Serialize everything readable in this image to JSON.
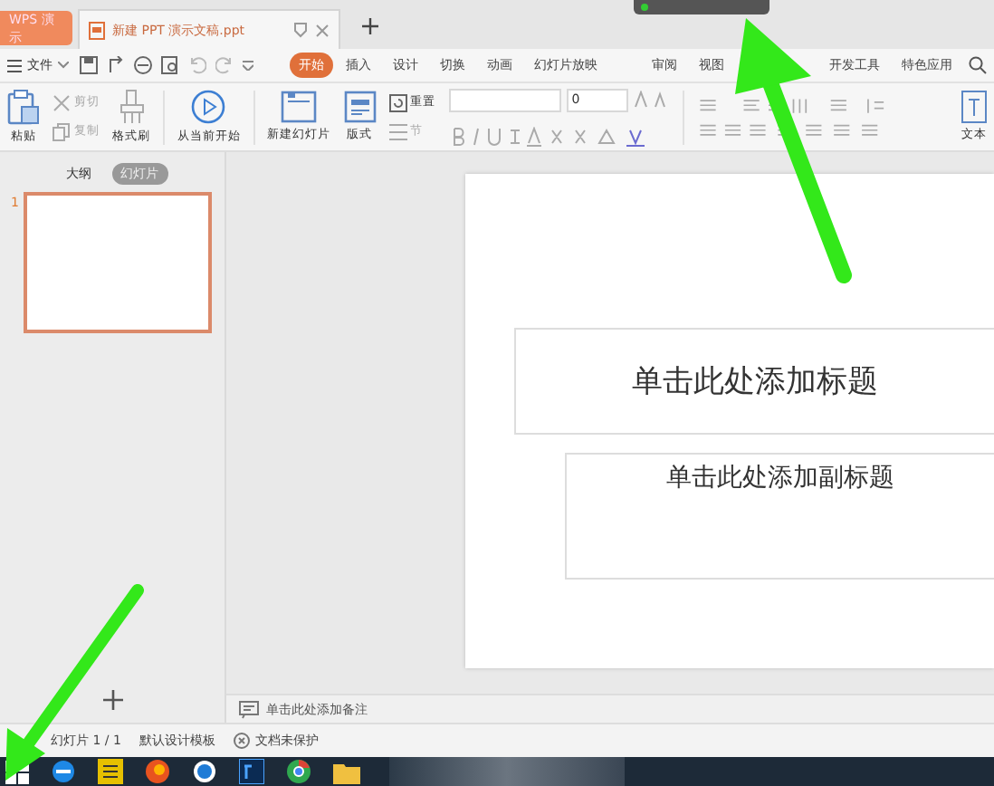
{
  "app_tabs": [
    {
      "label": "WPS 演示",
      "kind": "app",
      "selected": false
    },
    {
      "label": "新建 PPT 演示文稿.ppt",
      "kind": "doc",
      "selected": true
    }
  ],
  "menu": {
    "file": "文件",
    "items": [
      {
        "label": "开始",
        "selected": true
      },
      {
        "label": "插入",
        "selected": false
      },
      {
        "label": "设计",
        "selected": false
      },
      {
        "label": "切换",
        "selected": false
      },
      {
        "label": "动画",
        "selected": false
      },
      {
        "label": "幻灯片放映",
        "selected": false
      },
      {
        "label": "审阅",
        "selected": false
      },
      {
        "label": "视图",
        "selected": false
      },
      {
        "label": "开发工具",
        "selected": false
      },
      {
        "label": "特色应用",
        "selected": false
      }
    ]
  },
  "ribbon": {
    "paste": "粘贴",
    "cut": "剪切",
    "copy": "复制",
    "format_painter": "格式刷",
    "play": "从当前开始",
    "new_slide": "新建幻灯片",
    "layout": "版式",
    "reset": "重置",
    "section": "节",
    "font_size": "0",
    "text": "文本"
  },
  "panel": {
    "tabs": [
      {
        "label": "大纲",
        "selected": false
      },
      {
        "label": "幻灯片",
        "selected": true
      }
    ],
    "slides": [
      {
        "number": "1",
        "selected": true
      }
    ]
  },
  "slide": {
    "title": "单击此处添加标题",
    "subtitle": "单击此处添加副标题"
  },
  "notes": {
    "placeholder": "单击此处添加备注"
  },
  "status_bar": [
    "幻灯片 1 / 1",
    "默认设计模板",
    "文档未保护"
  ]
}
